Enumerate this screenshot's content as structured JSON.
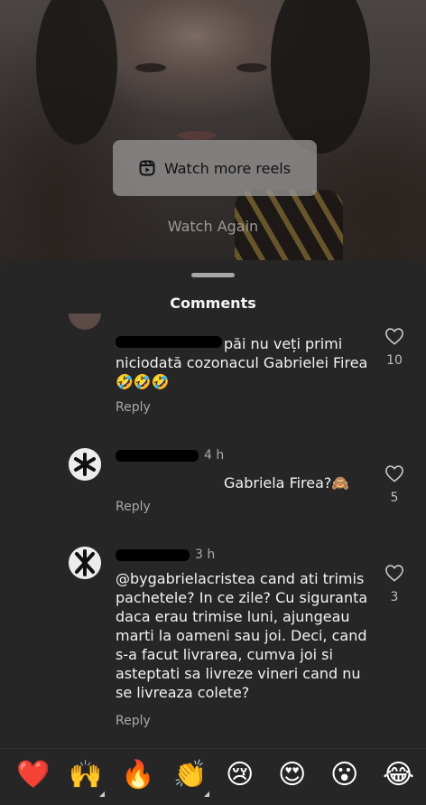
{
  "video": {
    "watch_more_label": "Watch more reels",
    "watch_again_label": "Watch Again"
  },
  "sheet": {
    "title": "Comments"
  },
  "comments": [
    {
      "username": "",
      "time": "",
      "text": "păi nu veți primi niciodată cozonacul Gabrielei Firea 🤣🤣🤣",
      "likes": "10",
      "reply_label": "Reply"
    },
    {
      "username": "",
      "time": "4 h",
      "text": "Gabriela Firea?🙈",
      "likes": "5",
      "reply_label": "Reply"
    },
    {
      "username": "",
      "time": "3 h",
      "text": "@bygabrielacristea cand ati trimis pachetele? In ce zile? Cu siguranta daca erau trimise luni, ajungeau marti la oameni sau joi. Deci, cand s-a facut livrarea, cumva joi si asteptati sa livreze vineri cand nu se livreaza colete?",
      "likes": "3",
      "reply_label": "Reply"
    }
  ],
  "emoji_bar": {
    "items": [
      "❤️",
      "🙌",
      "🔥",
      "👏",
      "😢",
      "😍",
      "😮",
      "😂"
    ]
  },
  "icons": {
    "like": "heart-outline-icon",
    "reels": "reels-icon"
  },
  "colors": {
    "sheet_bg": "#262626",
    "button_bg": "#969494",
    "muted_text": "#a8a8a8"
  }
}
